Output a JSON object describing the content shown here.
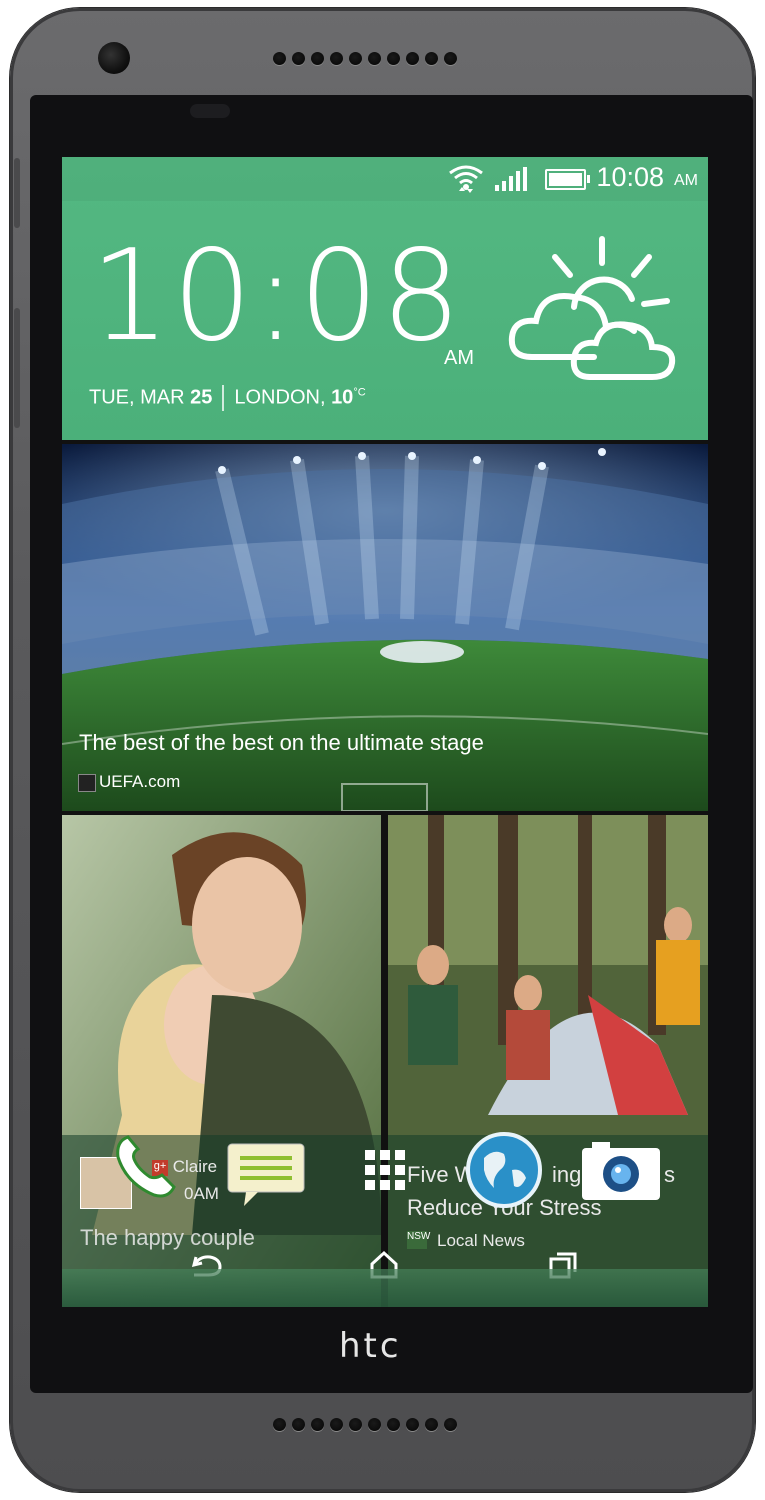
{
  "device": {
    "brand": "htc"
  },
  "statusbar": {
    "time": "10:08",
    "ampm": "AM",
    "icons": [
      "wifi-icon",
      "signal-icon",
      "battery-icon"
    ]
  },
  "clock": {
    "time": "10:08",
    "ampm": "AM",
    "day": "TUE, MAR",
    "date": "25",
    "city": "LONDON,",
    "temp": "10",
    "temp_unit": "°C",
    "weather_icon": "partly-sunny-icon"
  },
  "news": {
    "headline": "The best of the best on the ultimate stage",
    "source": "UEFA.com"
  },
  "tiles": [
    {
      "title": "The happy couple",
      "sender": "Claire",
      "time": "0AM"
    },
    {
      "title_line1": "Five W",
      "title_line1_end": "ing",
      "title_line1_tail": "s",
      "title_line2": "Reduce Your Stress",
      "source": "Local News"
    }
  ],
  "dock": {
    "apps": [
      "phone-icon",
      "messages-icon",
      "app-drawer-icon",
      "browser-icon",
      "camera-icon"
    ]
  },
  "nav": {
    "buttons": [
      "back-icon",
      "home-icon",
      "recents-icon"
    ]
  }
}
